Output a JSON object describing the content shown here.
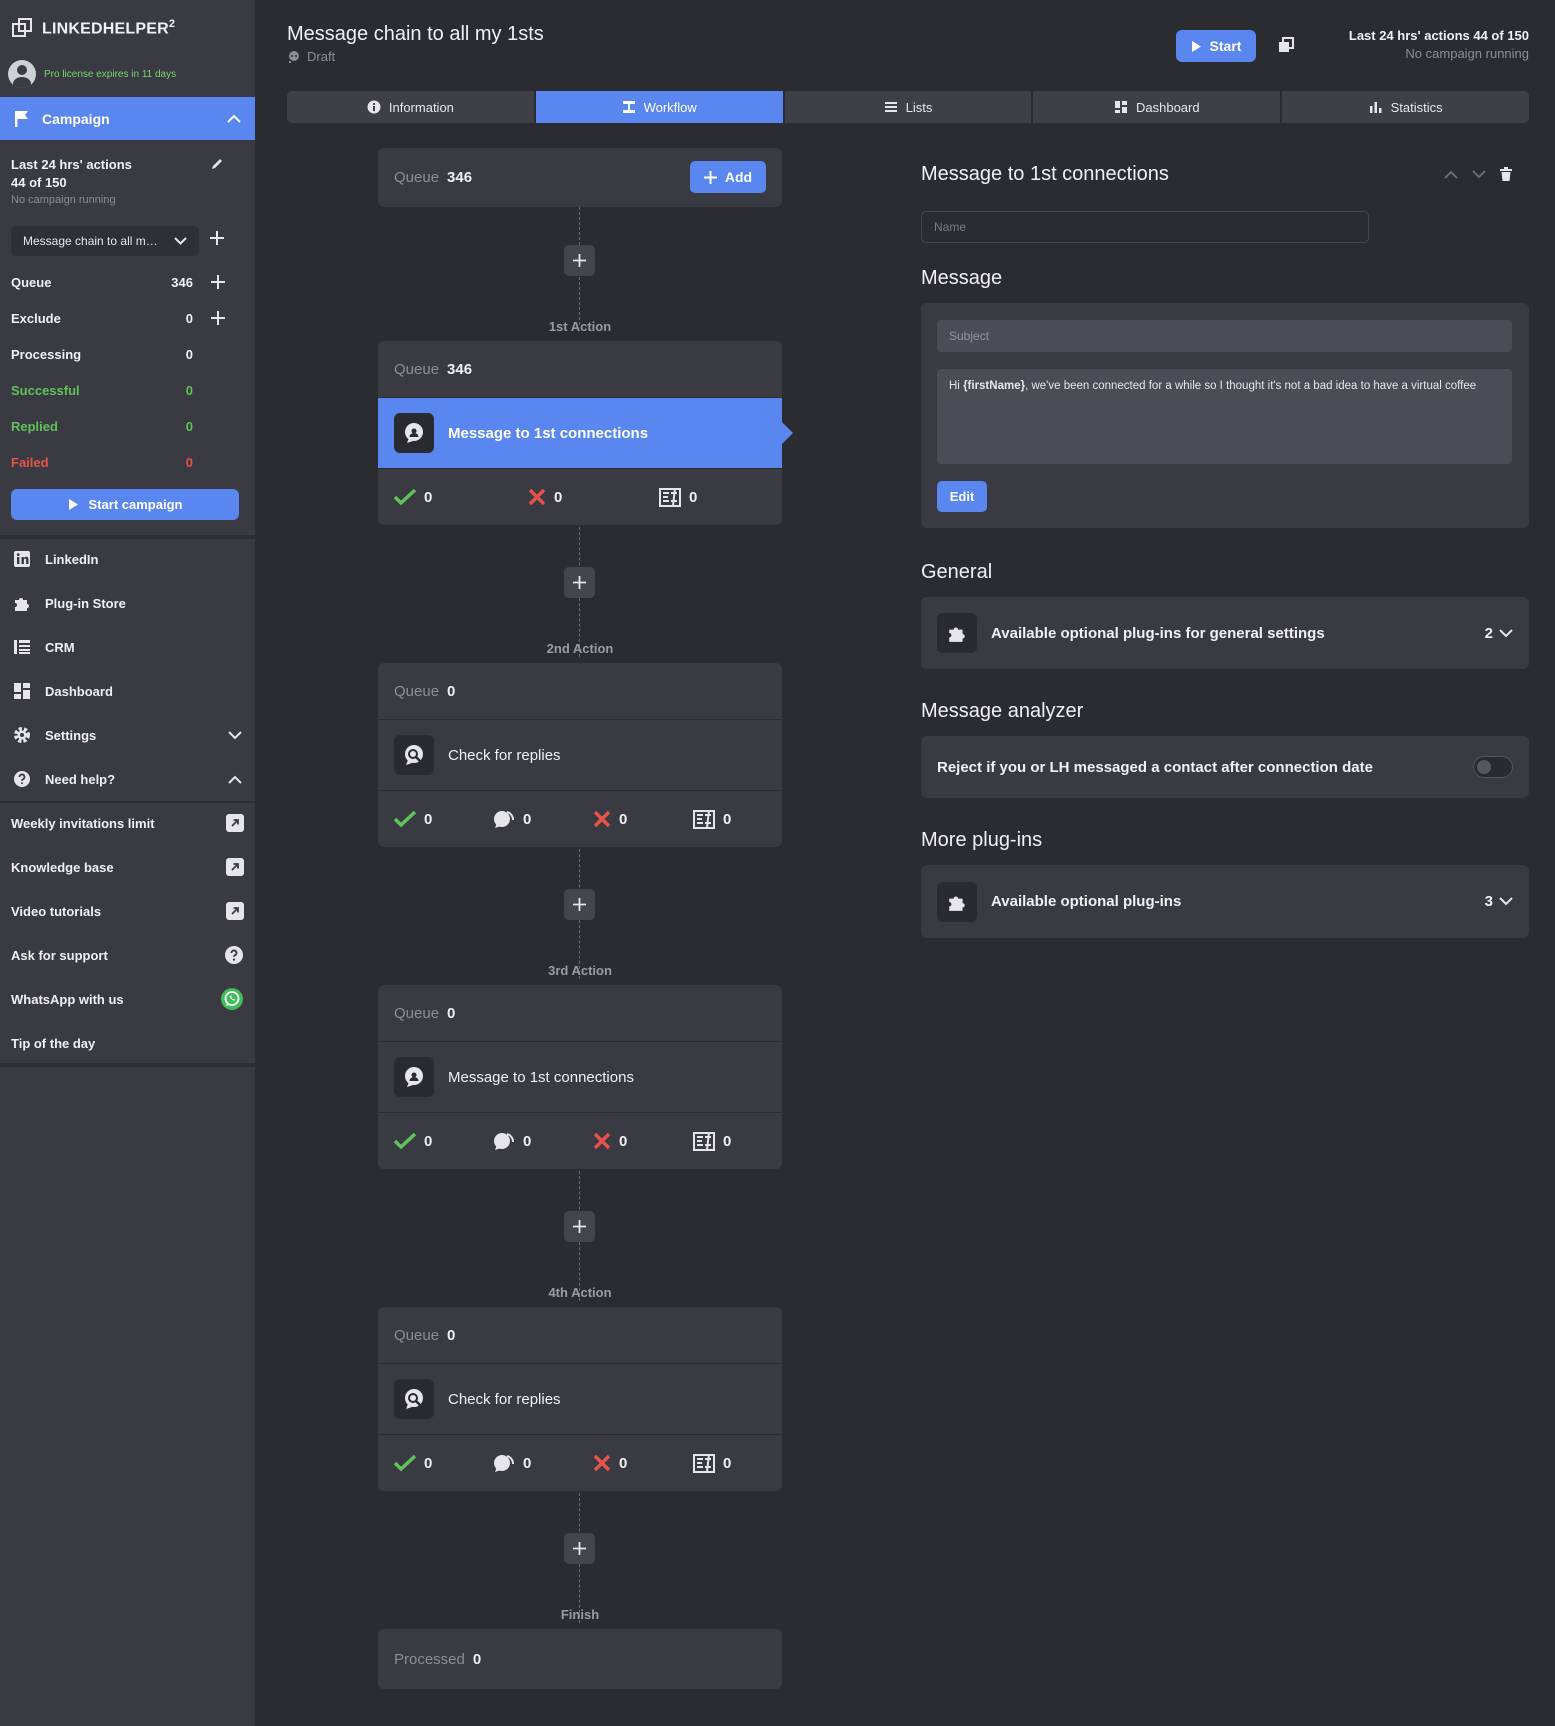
{
  "app": {
    "logo_text": "LINKEDHELPER",
    "logo_sup": "2",
    "license": "Pro license expires in 11 days"
  },
  "sidebar": {
    "campaign_label": "Campaign",
    "actions_title_1": "Last 24 hrs' actions",
    "actions_title_2": "44 of 150",
    "actions_sub": "No campaign running",
    "campaign_select": "Message chain to all m…",
    "stats": [
      {
        "label": "Queue",
        "value": "346",
        "color": "#f0f0f3"
      },
      {
        "label": "Exclude",
        "value": "0",
        "color": "#f0f0f3"
      },
      {
        "label": "Processing",
        "value": "0",
        "color": "#f0f0f3"
      },
      {
        "label": "Successful",
        "value": "0",
        "color": "#5fc35a"
      },
      {
        "label": "Replied",
        "value": "0",
        "color": "#5fc35a"
      },
      {
        "label": "Failed",
        "value": "0",
        "color": "#e5534b"
      }
    ],
    "start_campaign": "Start campaign",
    "nav": [
      {
        "label": "LinkedIn",
        "icon": "linkedin-icon"
      },
      {
        "label": "Plug-in Store",
        "icon": "puzzle-icon"
      },
      {
        "label": "CRM",
        "icon": "crm-icon"
      },
      {
        "label": "Dashboard",
        "icon": "dashboard-icon"
      },
      {
        "label": "Settings",
        "icon": "gear-icon"
      },
      {
        "label": "Need help?",
        "icon": "help-icon"
      }
    ],
    "help": [
      {
        "label": "Weekly invitations limit",
        "icon": "external-link-icon"
      },
      {
        "label": "Knowledge base",
        "icon": "external-link-icon"
      },
      {
        "label": "Video tutorials",
        "icon": "external-link-icon"
      },
      {
        "label": "Ask for support",
        "icon": "question-icon"
      },
      {
        "label": "WhatsApp with us",
        "icon": "whatsapp-icon"
      },
      {
        "label": "Tip of the day",
        "icon": ""
      }
    ]
  },
  "header": {
    "title": "Message chain to all my 1sts",
    "status": "Draft",
    "start_label": "Start",
    "actions_line1": "Last 24 hrs' actions 44 of 150",
    "actions_line2": "No campaign running"
  },
  "tabs": [
    {
      "label": "Information",
      "icon": "info-icon"
    },
    {
      "label": "Workflow",
      "icon": "workflow-icon"
    },
    {
      "label": "Lists",
      "icon": "list-icon"
    },
    {
      "label": "Dashboard",
      "icon": "dashboard-icon"
    },
    {
      "label": "Statistics",
      "icon": "bar-chart-icon"
    }
  ],
  "workflow": {
    "queue_label": "Queue",
    "top_queue": "346",
    "add_label": "Add",
    "actions": [
      {
        "label": "1st Action",
        "queue": "346",
        "name": "Message to 1st connections",
        "type": "message",
        "stats": [
          "0",
          "0",
          "0"
        ]
      },
      {
        "label": "2nd Action",
        "queue": "0",
        "name": "Check for replies",
        "type": "check",
        "stats": [
          "0",
          "0",
          "0",
          "0"
        ]
      },
      {
        "label": "3rd Action",
        "queue": "0",
        "name": "Message to 1st connections",
        "type": "message",
        "stats": [
          "0",
          "0",
          "0",
          "0"
        ]
      },
      {
        "label": "4th Action",
        "queue": "0",
        "name": "Check for replies",
        "type": "check",
        "stats": [
          "0",
          "0",
          "0",
          "0"
        ]
      }
    ],
    "finish_label": "Finish",
    "processed_label": "Processed",
    "processed_value": "0"
  },
  "panel": {
    "title": "Message to 1st connections",
    "name_placeholder": "Name",
    "message_heading": "Message",
    "subject_placeholder": "Subject",
    "body_prefix": "Hi ",
    "body_var": "{firstName}",
    "body_rest": ", we've been connected for a while so I thought it's not a bad idea to have a virtual coffee",
    "edit_label": "Edit",
    "general_heading": "General",
    "general_plugins": "Available optional plug-ins for general settings",
    "general_count": "2",
    "analyzer_heading": "Message analyzer",
    "analyzer_option": "Reject if you or LH messaged a contact after connection date",
    "more_heading": "More plug-ins",
    "more_plugins": "Available optional plug-ins",
    "more_count": "3"
  }
}
